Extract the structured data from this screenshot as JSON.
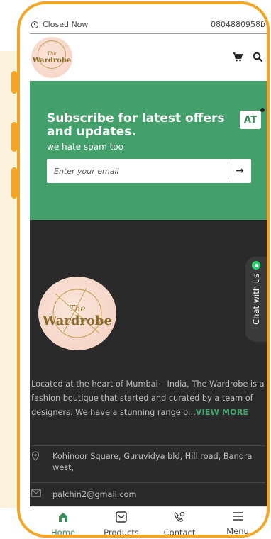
{
  "status_bar": {
    "status": "Closed Now",
    "phone": "0804880958ɓ"
  },
  "header": {
    "logo_the": "The",
    "logo_word": "Wardrobe"
  },
  "subscribe": {
    "title": "Subscribe for latest offers and updates.",
    "subtitle": "we hate spam too",
    "email_placeholder": "Enter your email",
    "submit_arrow": "→",
    "badge": "AT"
  },
  "footer": {
    "logo_the": "The",
    "logo_word": "Wardrobe",
    "about": "Located at the heart of Mumbai – India, The Wardrobe is a fashion boutique that started and curated by a team of designers. We have a stunning range o...",
    "view_more": "VIEW MORE",
    "address": "Kohinoor Square, Guruvidya bld, Hill road, Bandra west,",
    "email": "palchin2@gmail.com"
  },
  "chat": {
    "label": "Chat with us"
  },
  "bottom_nav": [
    {
      "label": "Home",
      "icon": "home-icon",
      "active": true
    },
    {
      "label": "Products",
      "icon": "bag-icon",
      "active": false
    },
    {
      "label": "Contact",
      "icon": "phone-icon",
      "active": false
    },
    {
      "label": "Menu",
      "icon": "menu-icon",
      "active": false
    }
  ],
  "colors": {
    "accent": "#43a06a",
    "frame": "#f5a524",
    "footer_bg": "#2a2a2a"
  }
}
